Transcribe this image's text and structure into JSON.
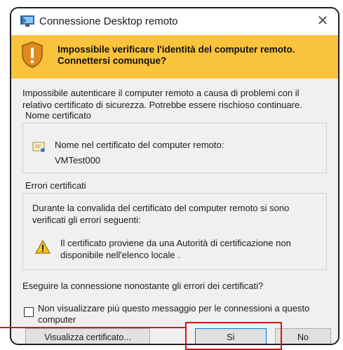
{
  "window": {
    "title": "Connessione Desktop remoto",
    "close_glyph": "✕"
  },
  "banner": {
    "text_line1": "Impossibile verificare l'identità del computer remoto.",
    "text_line2": "Connettersi comunque?",
    "background": "#f9c33b"
  },
  "description": "Impossibile autenticare il computer remoto a causa di problemi con il relativo certificato di sicurezza. Potrebbe essere rischioso continuare.",
  "cert_group": {
    "label": "Nome certificato",
    "field_label": "Nome nel certificato del computer remoto:",
    "field_value": "VMTest000"
  },
  "errors_group": {
    "label": "Errori certificati",
    "intro": "Durante la convalida del certificato del computer remoto si sono verificati gli errori seguenti:",
    "item": "Il certificato proviene da una Autorità di certificazione non disponibile nell'elenco locale ."
  },
  "question": "Eseguire la connessione nonostante gli errori dei certificati?",
  "dont_show": {
    "label": "Non visualizzare più questo messaggio per le connessioni a questo computer",
    "checked": false
  },
  "buttons": {
    "view_cert": "Visualizza certificato...",
    "yes": "Sì",
    "no": "No"
  },
  "annotation": {
    "highlight_color": "#d01818"
  }
}
